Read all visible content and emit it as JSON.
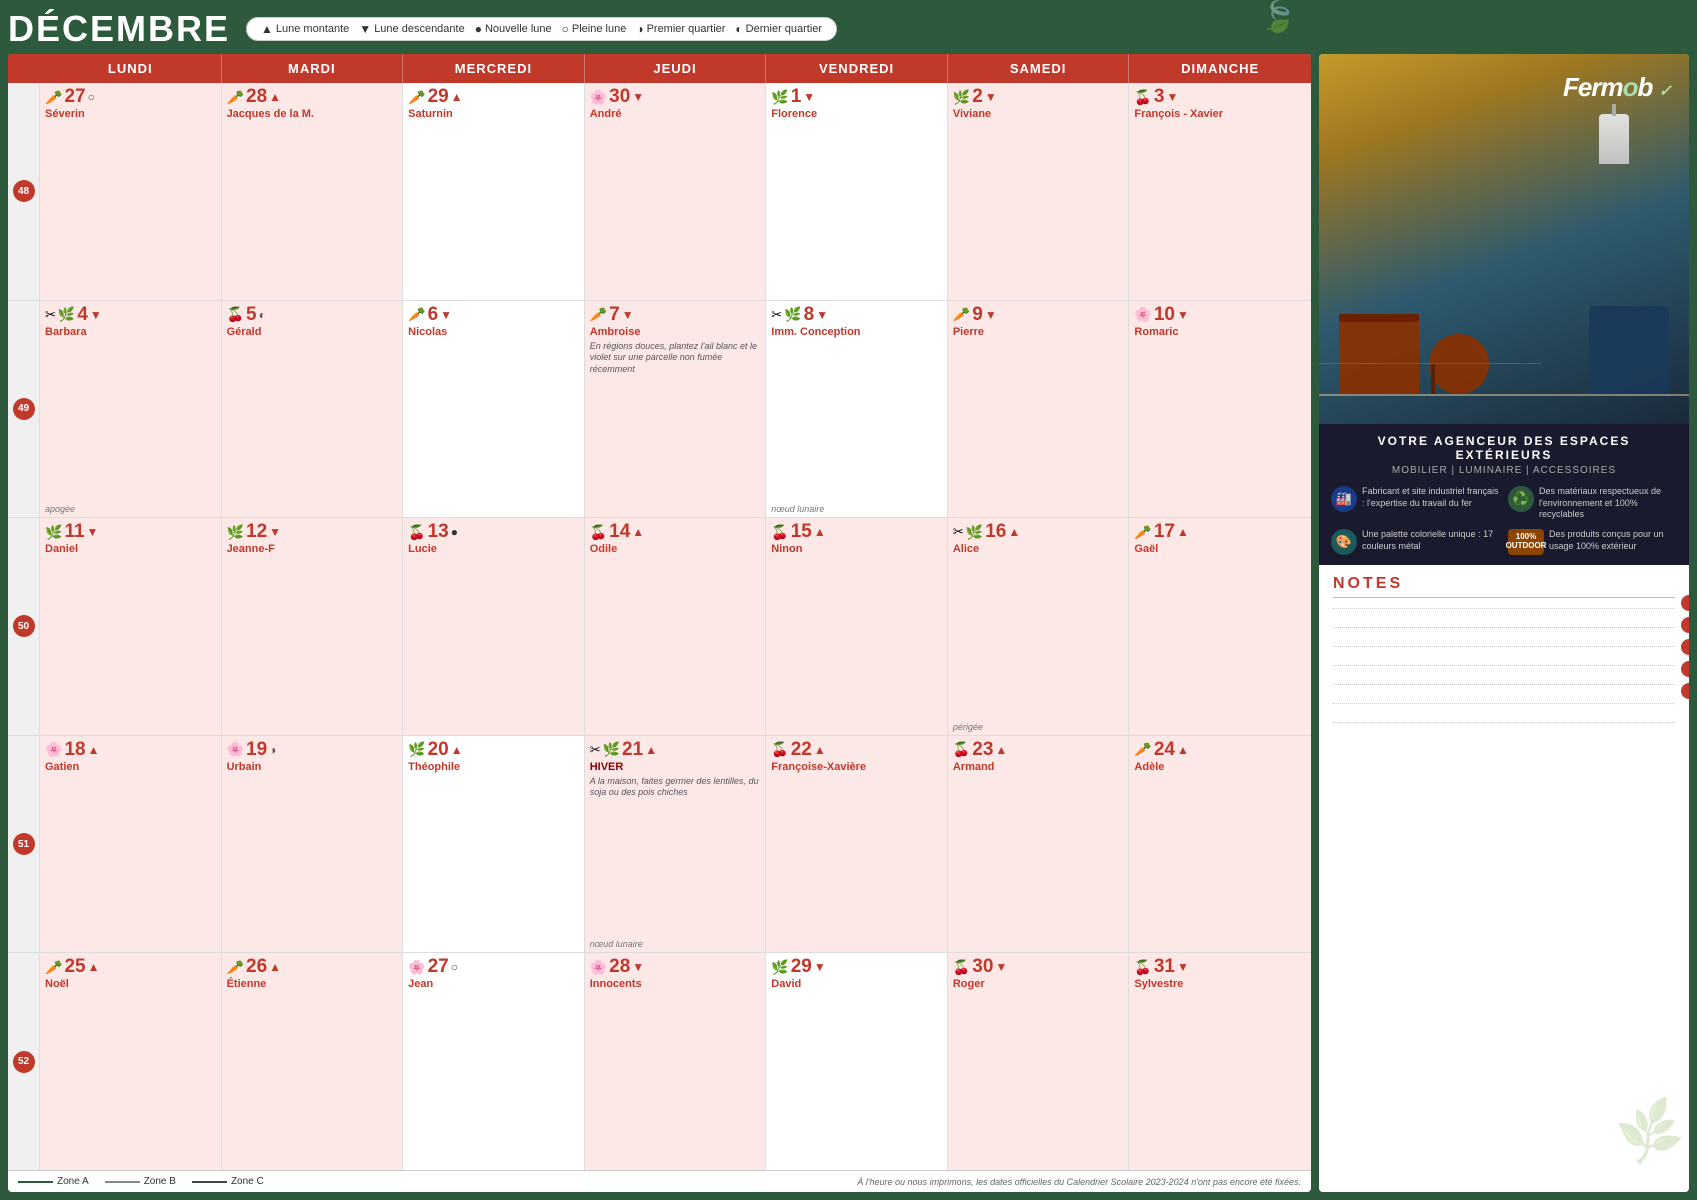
{
  "header": {
    "month": "DÉCEMBRE",
    "moon_legend": [
      {
        "symbol": "▲",
        "label": "Lune montante",
        "type": "up"
      },
      {
        "symbol": "▼",
        "label": "Lune descendante",
        "type": "down"
      },
      {
        "symbol": "●",
        "label": "Nouvelle lune",
        "type": "new"
      },
      {
        "symbol": "○",
        "label": "Pleine lune",
        "type": "full"
      },
      {
        "symbol": "◑",
        "label": "Premier quartier",
        "type": "fq"
      },
      {
        "symbol": "◐",
        "label": "Dernier quartier",
        "type": "lq"
      }
    ]
  },
  "days": [
    "LUNDI",
    "MARDI",
    "MERCREDI",
    "JEUDI",
    "VENDREDI",
    "SAMEDI",
    "DIMANCHE"
  ],
  "weeks": [
    {
      "num": 48,
      "days": [
        {
          "date": "27",
          "moon": "○",
          "icon": "carrot",
          "name": "Séverin",
          "bg": "pink",
          "nameColor": "red"
        },
        {
          "date": "28",
          "moon": "▲",
          "icon": "carrot",
          "name": "Jacques de la M.",
          "bg": "pink",
          "nameColor": "red"
        },
        {
          "date": "29",
          "moon": "▲",
          "icon": "carrot",
          "name": "Saturnin",
          "bg": "white",
          "nameColor": "red"
        },
        {
          "date": "30",
          "moon": "▼",
          "icon": "flower",
          "name": "André",
          "bg": "pink",
          "nameColor": "red"
        },
        {
          "date": "1",
          "moon": "▼",
          "icon": "leaf",
          "name": "Florence",
          "bg": "white",
          "nameColor": "red"
        },
        {
          "date": "2",
          "moon": "▼",
          "icon": "leaf",
          "name": "Viviane",
          "bg": "pink",
          "nameColor": "red"
        },
        {
          "date": "3",
          "moon": "▼",
          "icon": "cherry",
          "name": "François - Xavier",
          "bg": "pink",
          "nameColor": "red"
        }
      ],
      "extras": {}
    },
    {
      "num": 49,
      "days": [
        {
          "date": "4",
          "moon": "▼",
          "icon": "scissor",
          "name": "Barbara",
          "bg": "pink",
          "nameColor": "red"
        },
        {
          "date": "5",
          "moon": "◐",
          "icon": "cherry",
          "name": "Gérald",
          "bg": "pink",
          "nameColor": "red"
        },
        {
          "date": "6",
          "moon": "▼",
          "icon": "carrot",
          "name": "Nicolas",
          "bg": "white",
          "nameColor": "red"
        },
        {
          "date": "7",
          "moon": "▼",
          "icon": "carrot",
          "name": "Ambroise",
          "bg": "pink",
          "nameColor": "red",
          "note": "En régions douces, plantez l'ail blanc et le violet sur une parcelle non fumée récemment"
        },
        {
          "date": "8",
          "moon": "▼",
          "icon": "scissor",
          "name": "Imm. Conception",
          "bg": "white",
          "nameColor": "red"
        },
        {
          "date": "9",
          "moon": "▼",
          "icon": "carrot",
          "name": "Pierre",
          "bg": "pink",
          "nameColor": "red"
        },
        {
          "date": "10",
          "moon": "▼",
          "icon": "flower",
          "name": "Romaric",
          "bg": "pink",
          "nameColor": "red"
        }
      ],
      "extras": {
        "monday": "apogée",
        "friday": "nœud lunaire"
      }
    },
    {
      "num": 50,
      "days": [
        {
          "date": "11",
          "moon": "▼",
          "icon": "leaf",
          "name": "Daniel",
          "bg": "pink",
          "nameColor": "red"
        },
        {
          "date": "12",
          "moon": "▼",
          "icon": "leaf",
          "name": "Jeanne-F",
          "bg": "pink",
          "nameColor": "red"
        },
        {
          "date": "13",
          "moon": "●",
          "icon": "cherry",
          "name": "Lucie",
          "bg": "pink",
          "nameColor": "red"
        },
        {
          "date": "14",
          "moon": "▲",
          "icon": "cherry",
          "name": "Odile",
          "bg": "pink",
          "nameColor": "red"
        },
        {
          "date": "15",
          "moon": "▲",
          "icon": "cherry",
          "name": "Ninon",
          "bg": "pink",
          "nameColor": "red"
        },
        {
          "date": "16",
          "moon": "▲",
          "icon": "scissor",
          "name": "Alice",
          "bg": "pink",
          "nameColor": "red"
        },
        {
          "date": "17",
          "moon": "▲",
          "icon": "carrot",
          "name": "Gaël",
          "bg": "pink",
          "nameColor": "red"
        }
      ],
      "extras": {
        "saturday": "périgée"
      }
    },
    {
      "num": 51,
      "days": [
        {
          "date": "18",
          "moon": "▲",
          "icon": "flower",
          "name": "Gatien",
          "bg": "pink",
          "nameColor": "red"
        },
        {
          "date": "19",
          "moon": "◑",
          "icon": "flower",
          "name": "Urbain",
          "bg": "pink",
          "nameColor": "red"
        },
        {
          "date": "20",
          "moon": "▲",
          "icon": "leaf",
          "name": "Théophile",
          "bg": "white",
          "nameColor": "red"
        },
        {
          "date": "21",
          "moon": "▲",
          "icon": "scissor",
          "name": "HIVER",
          "bg": "pink",
          "nameColor": "darkred",
          "note": "A la maison, faites germer des lentilles, du soja ou des pois chiches",
          "bold": true
        },
        {
          "date": "22",
          "moon": "▲",
          "icon": "cherry",
          "name": "Françoise-Xavière",
          "bg": "pink",
          "nameColor": "red"
        },
        {
          "date": "23",
          "moon": "▲",
          "icon": "cherry",
          "name": "Armand",
          "bg": "pink",
          "nameColor": "red"
        },
        {
          "date": "24",
          "moon": "▲",
          "icon": "carrot",
          "name": "Adèle",
          "bg": "pink",
          "nameColor": "red"
        }
      ],
      "extras": {
        "thursday": "nœud lunaire"
      }
    },
    {
      "num": 52,
      "days": [
        {
          "date": "25",
          "moon": "▲",
          "icon": "carrot",
          "name": "Noël",
          "bg": "pink",
          "nameColor": "red"
        },
        {
          "date": "26",
          "moon": "▲",
          "icon": "carrot",
          "name": "Étienne",
          "bg": "pink",
          "nameColor": "red"
        },
        {
          "date": "27",
          "moon": "○",
          "icon": "flower",
          "name": "Jean",
          "bg": "white",
          "nameColor": "red"
        },
        {
          "date": "28",
          "moon": "▼",
          "icon": "flower",
          "name": "Innocents",
          "bg": "pink",
          "nameColor": "red"
        },
        {
          "date": "29",
          "moon": "▼",
          "icon": "leaf",
          "name": "David",
          "bg": "white",
          "nameColor": "red"
        },
        {
          "date": "30",
          "moon": "▼",
          "icon": "cherry",
          "name": "Roger",
          "bg": "pink",
          "nameColor": "red"
        },
        {
          "date": "31",
          "moon": "▼",
          "icon": "cherry",
          "name": "Sylvestre",
          "bg": "pink",
          "nameColor": "red"
        }
      ],
      "extras": {}
    }
  ],
  "footer": {
    "zones": [
      {
        "label": "Zone A",
        "color": "#2d5a3d"
      },
      {
        "label": "Zone B",
        "color": "#888888"
      },
      {
        "label": "Zone C",
        "color": "#444444"
      }
    ],
    "note": "À l'heure ou nous imprimons, les dates officielles du Calendrier Scolaire 2023-2024 n'ont pas encore été fixées."
  },
  "ad": {
    "brand": "Fermob",
    "tagline": "VOTRE AGENCEUR DES ESPACES EXTÉRIEURS",
    "subtitle": "MOBILIER | LUMINAIRE | ACCESSOIRES",
    "features": [
      {
        "icon": "🏭",
        "text": "Fabricant et site industriel français : l'expertise du travail du fer"
      },
      {
        "icon": "♻️",
        "text": "Des matériaux respectueux de l'environnement et 100% recyclables"
      },
      {
        "icon": "🎨",
        "text": "Une palette colorielle unique : 17 couleurs métal"
      },
      {
        "icon": "🏕️",
        "text": "Des produits conçus pour un usage 100% extérieur",
        "badge": "100% OUTDOOR"
      }
    ]
  },
  "notes": {
    "title": "NOTES"
  }
}
